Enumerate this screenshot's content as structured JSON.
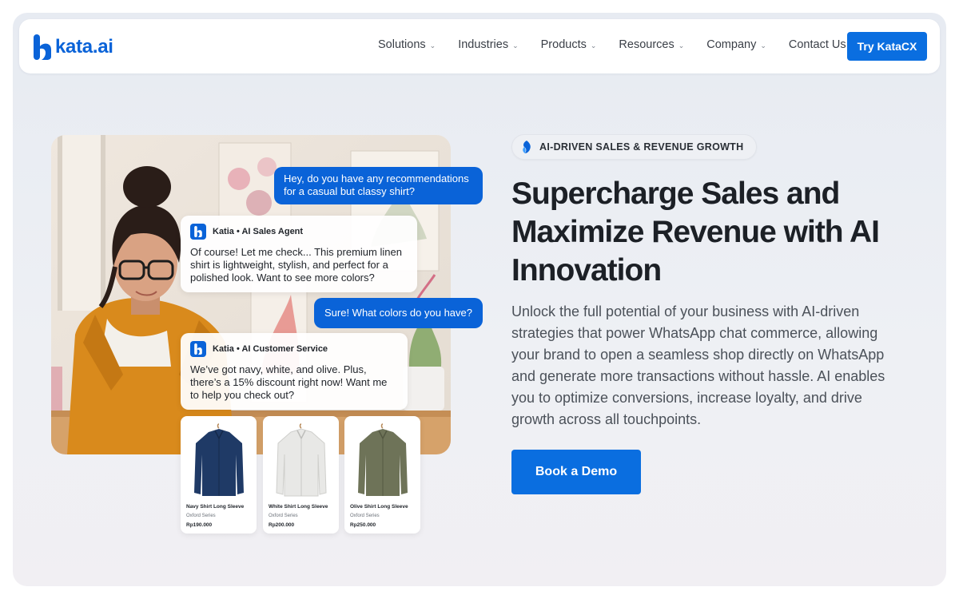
{
  "nav": {
    "logo_text": "kata.ai",
    "menu": [
      {
        "label": "Solutions",
        "has_dropdown": true
      },
      {
        "label": "Industries",
        "has_dropdown": true
      },
      {
        "label": "Products",
        "has_dropdown": true
      },
      {
        "label": "Resources",
        "has_dropdown": true
      },
      {
        "label": "Company",
        "has_dropdown": true
      },
      {
        "label": "Contact Us",
        "has_dropdown": false
      }
    ],
    "cta": "Try KataCX"
  },
  "chat": {
    "user_msg_1": "Hey, do you have any recommendations for a casual but classy shirt?",
    "bot_1_name": "Katia • AI Sales Agent",
    "bot_1_msg": "Of course! Let me check... This premium linen shirt is lightweight, stylish, and perfect for a polished look. Want to see more colors?",
    "user_msg_2": "Sure! What colors do you have?",
    "bot_2_name": "Katia • AI Customer Service",
    "bot_2_msg": "We’ve got navy, white, and olive. Plus, there’s a 15% discount right now! Want me to help you check out?"
  },
  "products": [
    {
      "name": "Navy Shirt Long Sleeve",
      "series": "Oxford Series",
      "price": "Rp190.000",
      "color": "#1f3a66"
    },
    {
      "name": "White Shirt Long Sleeve",
      "series": "Oxford Series",
      "price": "Rp200.000",
      "color": "#e8e8e6"
    },
    {
      "name": "Olive Shirt Long Sleeve",
      "series": "Oxford Series",
      "price": "Rp250.000",
      "color": "#6e7358"
    }
  ],
  "hero": {
    "tag": "AI-DRIVEN SALES & REVENUE GROWTH",
    "headline": "Supercharge Sales and Maximize Revenue with AI Innovation",
    "description": "Unlock the full potential of your business with AI-driven strategies that power WhatsApp chat commerce, allowing your brand to open a seamless shop directly on WhatsApp and generate more transactions without hassle. AI enables you to optimize conversions, increase loyalty, and drive growth across all touchpoints.",
    "cta": "Book a Demo"
  },
  "colors": {
    "brand_blue": "#0a63d8",
    "button_blue": "#0a6ee0",
    "jacket_orange": "#d98a1c"
  }
}
